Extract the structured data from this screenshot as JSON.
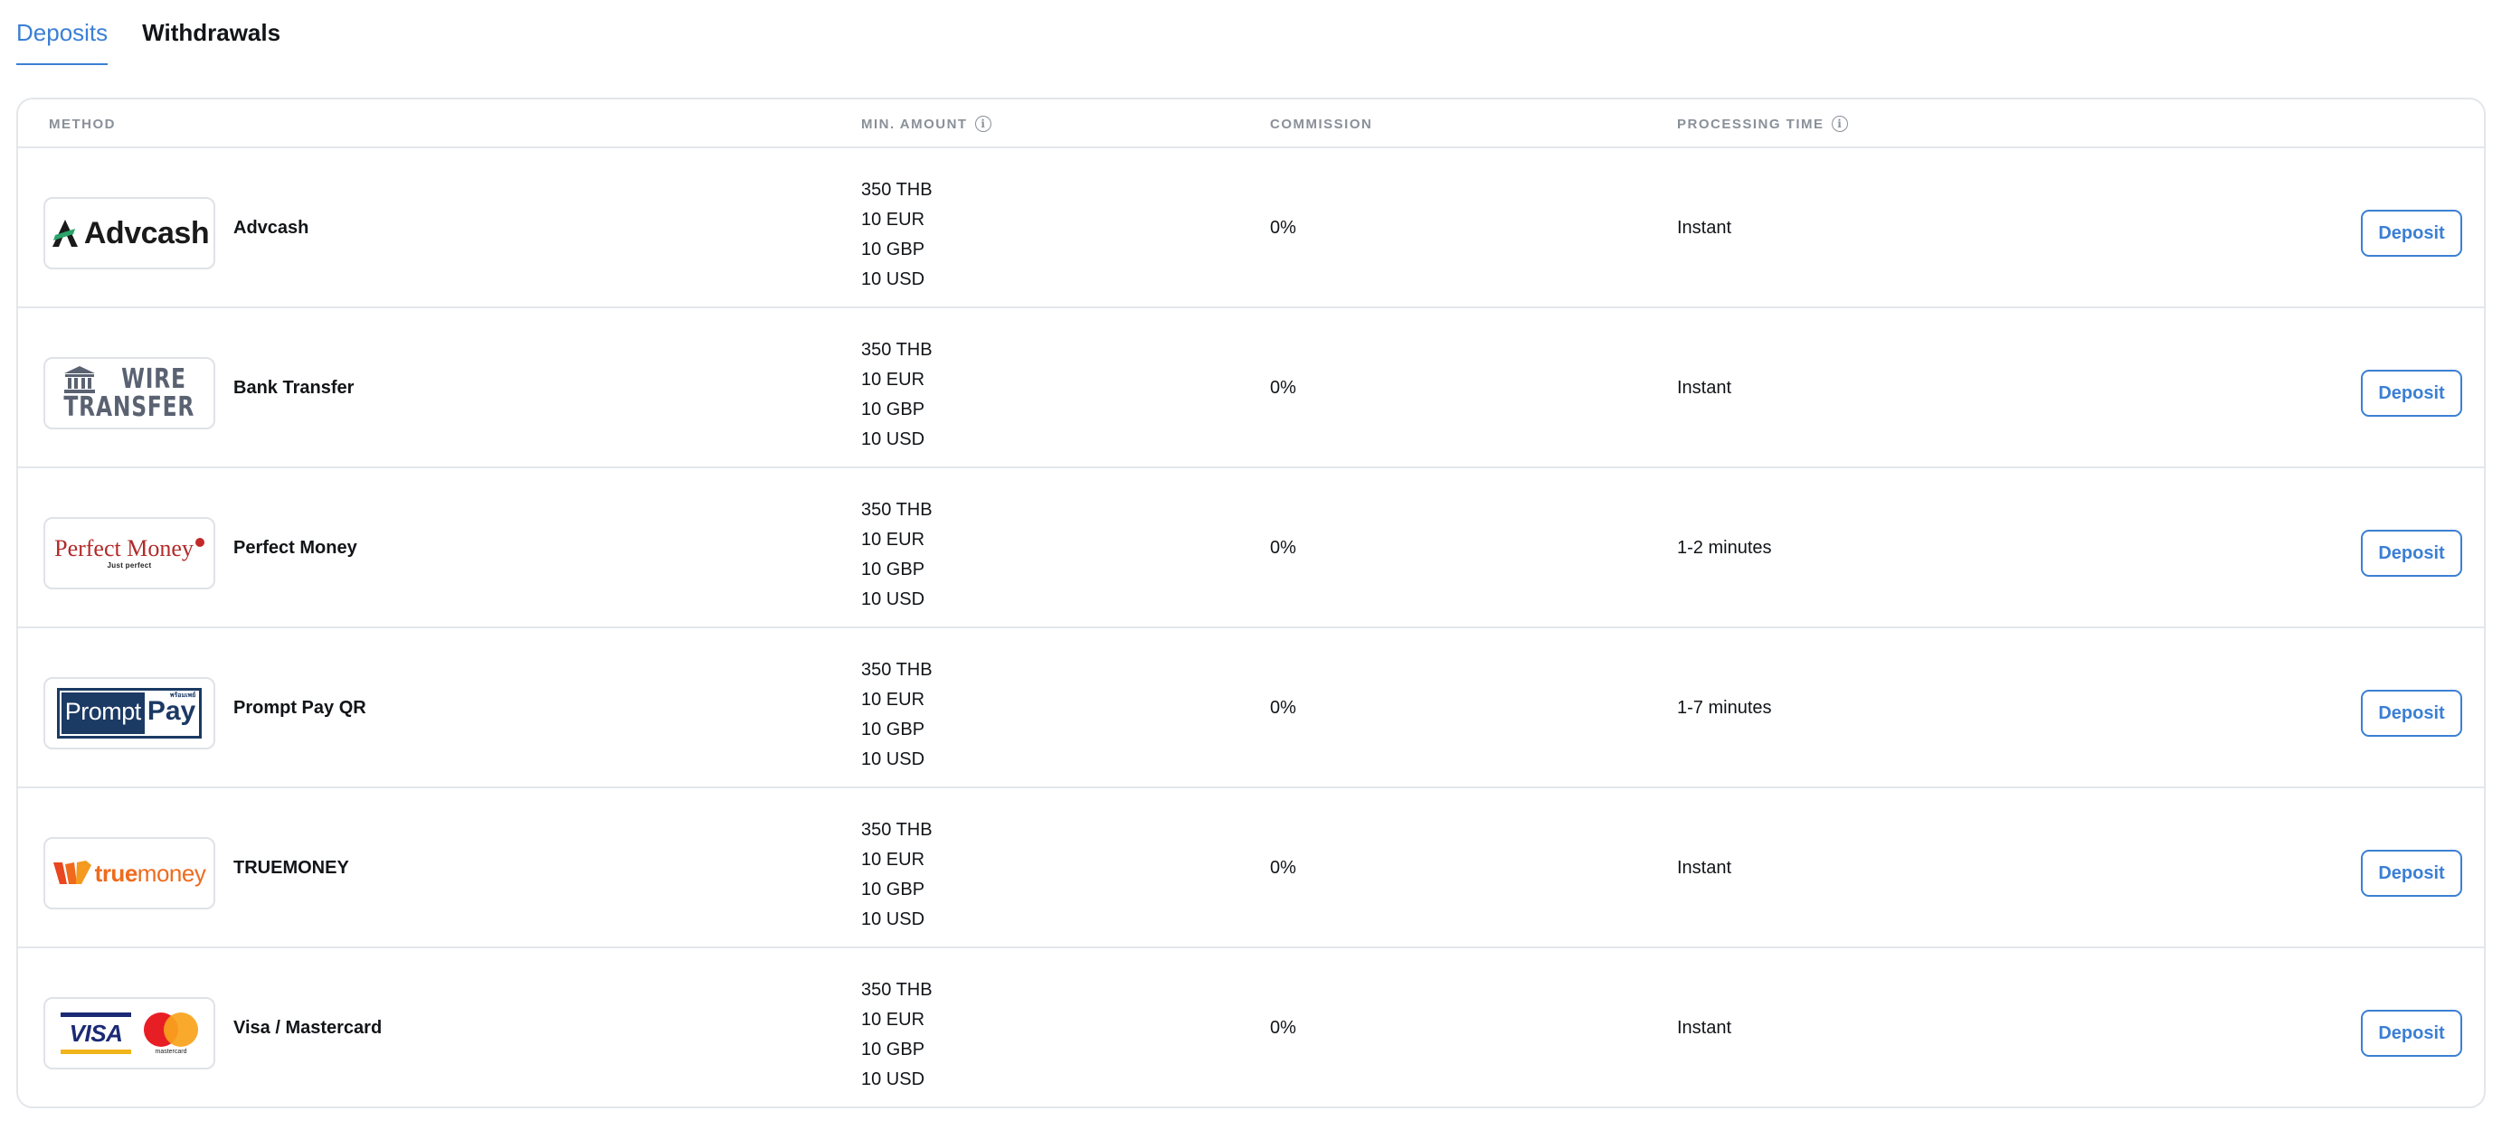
{
  "tabs": [
    {
      "label": "Deposits",
      "active": true
    },
    {
      "label": "Withdrawals",
      "active": false
    }
  ],
  "columns": {
    "method": "METHOD",
    "min_amount": "MIN. AMOUNT",
    "commission": "COMMISSION",
    "processing_time": "PROCESSING TIME",
    "info_icon": "i"
  },
  "colors": {
    "accent": "#3b7fd4",
    "border": "#e3e6ea",
    "header_text": "#8a9099"
  },
  "rows": [
    {
      "method": "Advcash",
      "logo": {
        "icon": "advcash-logo",
        "text": "Advcash"
      },
      "amounts": [
        "350 THB",
        "10 EUR",
        "10 GBP",
        "10 USD"
      ],
      "commission": "0%",
      "processing_time": "Instant",
      "action": "Deposit"
    },
    {
      "method": "Bank Transfer",
      "logo": {
        "icon": "wire-transfer-logo",
        "line1": "WIRE",
        "line2": "TRANSFER"
      },
      "amounts": [
        "350 THB",
        "10 EUR",
        "10 GBP",
        "10 USD"
      ],
      "commission": "0%",
      "processing_time": "Instant",
      "action": "Deposit"
    },
    {
      "method": "Perfect Money",
      "logo": {
        "icon": "perfect-money-logo",
        "text": "Perfect Money",
        "tagline": "Just perfect"
      },
      "amounts": [
        "350 THB",
        "10 EUR",
        "10 GBP",
        "10 USD"
      ],
      "commission": "0%",
      "processing_time": "1-2 minutes",
      "action": "Deposit"
    },
    {
      "method": "Prompt Pay QR",
      "logo": {
        "icon": "promptpay-logo",
        "prompt": "Prompt",
        "pay": "Pay",
        "thai": "พร้อมเพย์"
      },
      "amounts": [
        "350 THB",
        "10 EUR",
        "10 GBP",
        "10 USD"
      ],
      "commission": "0%",
      "processing_time": "1-7 minutes",
      "action": "Deposit"
    },
    {
      "method": "TRUEMONEY",
      "logo": {
        "icon": "truemoney-logo",
        "true": "true",
        "money": "money"
      },
      "amounts": [
        "350 THB",
        "10 EUR",
        "10 GBP",
        "10 USD"
      ],
      "commission": "0%",
      "processing_time": "Instant",
      "action": "Deposit"
    },
    {
      "method": "Visa / Mastercard",
      "logo": {
        "icon": "visa-mastercard-logo",
        "visa": "VISA",
        "mastercard": "mastercard"
      },
      "amounts": [
        "350 THB",
        "10 EUR",
        "10 GBP",
        "10 USD"
      ],
      "commission": "0%",
      "processing_time": "Instant",
      "action": "Deposit"
    }
  ]
}
